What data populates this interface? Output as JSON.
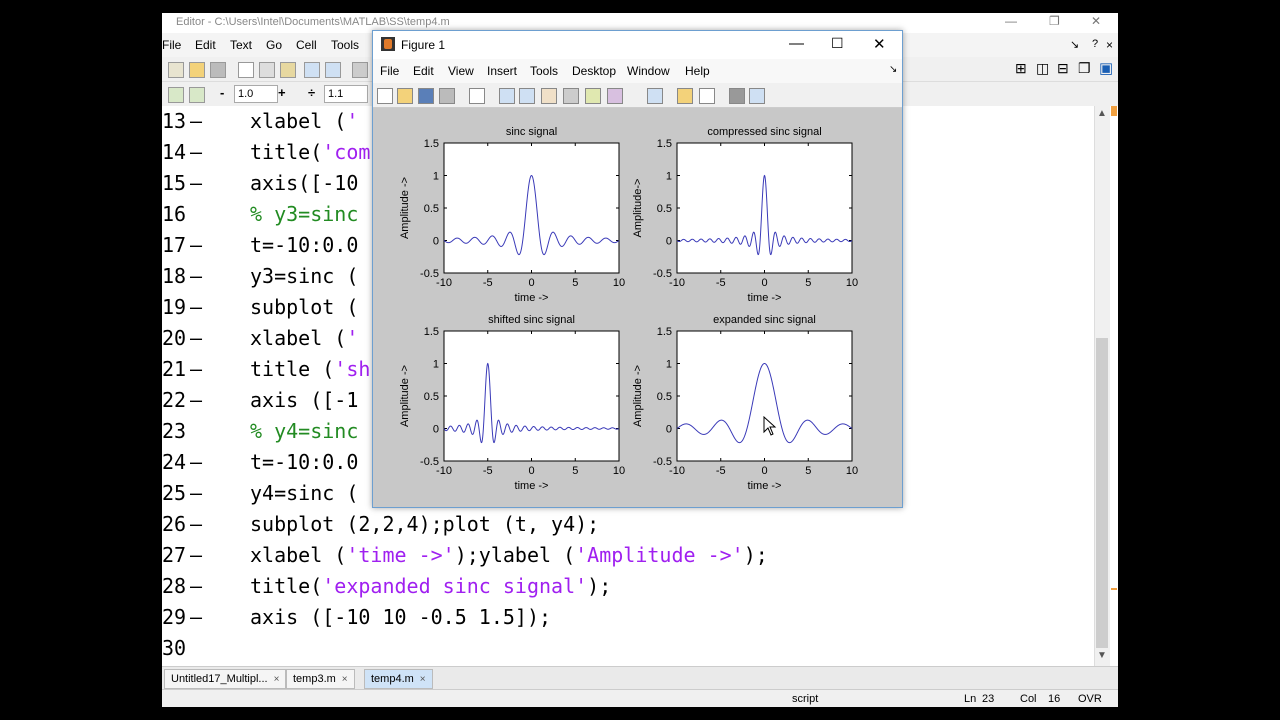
{
  "editor": {
    "title": "Editor - C:\\Users\\Intel\\Documents\\MATLAB\\SS\\temp4.m",
    "menu": [
      "File",
      "Edit",
      "Text",
      "Go",
      "Cell",
      "Tools"
    ],
    "toolbar": {
      "minus": "-",
      "input1": "1.0",
      "plus": "+",
      "divide": "÷",
      "input2": "1.1"
    },
    "dock_icons": [
      "⊞",
      "◫",
      "⊟",
      "❐",
      "▣"
    ],
    "titlebar_small_icons": [
      "↘",
      "?",
      "×"
    ],
    "code_lines": [
      {
        "num": "13",
        "dash": "—",
        "segments": [
          {
            "t": "xlabel (",
            "c": "k"
          },
          {
            "t": "'",
            "c": "s"
          }
        ]
      },
      {
        "num": "14",
        "dash": "—",
        "segments": [
          {
            "t": "title(",
            "c": "k"
          },
          {
            "t": "'com",
            "c": "s"
          }
        ]
      },
      {
        "num": "15",
        "dash": "—",
        "segments": [
          {
            "t": "axis([-10",
            "c": "k"
          }
        ]
      },
      {
        "num": "16",
        "dash": "",
        "segments": [
          {
            "t": "% y3=sinc",
            "c": "c"
          }
        ]
      },
      {
        "num": "17",
        "dash": "—",
        "segments": [
          {
            "t": "t=-10:0.0",
            "c": "k"
          }
        ]
      },
      {
        "num": "18",
        "dash": "—",
        "segments": [
          {
            "t": "y3=sinc (",
            "c": "k"
          }
        ]
      },
      {
        "num": "19",
        "dash": "—",
        "segments": [
          {
            "t": "subplot (",
            "c": "k"
          }
        ]
      },
      {
        "num": "20",
        "dash": "—",
        "segments": [
          {
            "t": "xlabel (",
            "c": "k"
          },
          {
            "t": "'",
            "c": "s"
          }
        ]
      },
      {
        "num": "21",
        "dash": "—",
        "segments": [
          {
            "t": "title (",
            "c": "k"
          },
          {
            "t": "'sh",
            "c": "s"
          }
        ]
      },
      {
        "num": "22",
        "dash": "—",
        "segments": [
          {
            "t": "axis ([-1",
            "c": "k"
          }
        ]
      },
      {
        "num": "23",
        "dash": "",
        "segments": [
          {
            "t": "% y4=sinc",
            "c": "c"
          }
        ]
      },
      {
        "num": "24",
        "dash": "—",
        "segments": [
          {
            "t": "t=-10:0.0",
            "c": "k"
          }
        ]
      },
      {
        "num": "25",
        "dash": "—",
        "segments": [
          {
            "t": "y4=sinc (",
            "c": "k"
          }
        ]
      },
      {
        "num": "26",
        "dash": "—",
        "segments": [
          {
            "t": "subplot (2,2,4);plot (t, y4);",
            "c": "k"
          }
        ]
      },
      {
        "num": "27",
        "dash": "—",
        "segments": [
          {
            "t": "xlabel (",
            "c": "k"
          },
          {
            "t": "'time ->'",
            "c": "s"
          },
          {
            "t": ");ylabel (",
            "c": "k"
          },
          {
            "t": "'Amplitude ->'",
            "c": "s"
          },
          {
            "t": ");",
            "c": "k"
          }
        ]
      },
      {
        "num": "28",
        "dash": "—",
        "segments": [
          {
            "t": "title(",
            "c": "k"
          },
          {
            "t": "'expanded sinc signal'",
            "c": "s"
          },
          {
            "t": ");",
            "c": "k"
          }
        ]
      },
      {
        "num": "29",
        "dash": "—",
        "segments": [
          {
            "t": "axis ([-10 10 -0.5 1.5]);",
            "c": "k"
          }
        ]
      },
      {
        "num": "30",
        "dash": "",
        "segments": []
      }
    ],
    "tabs": [
      {
        "label": "Untitled17_Multipl...",
        "active": false
      },
      {
        "label": "temp3.m",
        "active": false
      },
      {
        "label": "temp4.m",
        "active": true
      }
    ],
    "status": {
      "mode": "script",
      "ln_label": "Ln",
      "ln": "23",
      "col_label": "Col",
      "col": "16",
      "ovr": "OVR"
    }
  },
  "figure": {
    "title": "Figure 1",
    "menu": [
      "File",
      "Edit",
      "View",
      "Insert",
      "Tools",
      "Desktop",
      "Window",
      "Help"
    ]
  },
  "colors": {
    "plot_line": "#3a3ab8",
    "string": "#a020f0",
    "comment": "#228b22",
    "figure_bg": "#c8c8c8"
  },
  "chart_data": [
    {
      "type": "line",
      "title": "sinc signal",
      "xlabel": "time ->",
      "ylabel": "Amplitude ->",
      "function": "sinc(t)",
      "xlim": [
        -10,
        10
      ],
      "ylim": [
        -0.5,
        1.5
      ],
      "xticks": [
        -10,
        -5,
        0,
        5,
        10
      ],
      "yticks": [
        -0.5,
        0,
        0.5,
        1,
        1.5
      ]
    },
    {
      "type": "line",
      "title": "compressed sinc signal",
      "xlabel": "time ->",
      "ylabel": "Amplitude->",
      "function": "sinc(2t)",
      "xlim": [
        -10,
        10
      ],
      "ylim": [
        -0.5,
        1.5
      ],
      "xticks": [
        -10,
        -5,
        0,
        5,
        10
      ],
      "yticks": [
        -0.5,
        0,
        0.5,
        1,
        1.5
      ]
    },
    {
      "type": "line",
      "title": "shifted sinc signal",
      "xlabel": "time ->",
      "ylabel": "Amplitude ->",
      "function": "sinc(2(t+5))",
      "xlim": [
        -10,
        10
      ],
      "ylim": [
        -0.5,
        1.5
      ],
      "xticks": [
        -10,
        -5,
        0,
        5,
        10
      ],
      "yticks": [
        -0.5,
        0,
        0.5,
        1,
        1.5
      ]
    },
    {
      "type": "line",
      "title": "expanded sinc signal",
      "xlabel": "time ->",
      "ylabel": "Amplitude ->",
      "function": "sinc(t/2)",
      "xlim": [
        -10,
        10
      ],
      "ylim": [
        -0.5,
        1.5
      ],
      "xticks": [
        -10,
        -5,
        0,
        5,
        10
      ],
      "yticks": [
        -0.5,
        0,
        0.5,
        1,
        1.5
      ]
    }
  ]
}
